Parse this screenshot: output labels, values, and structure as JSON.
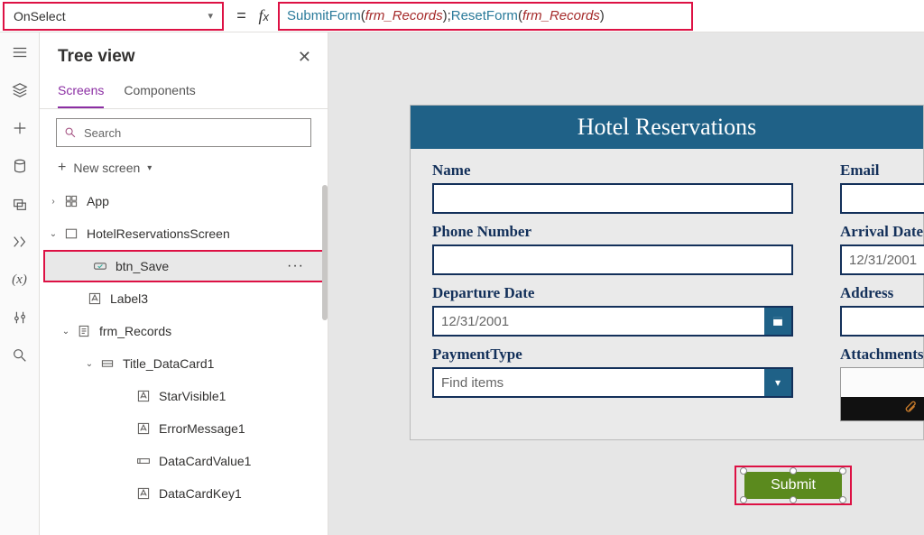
{
  "property_selector": {
    "value": "OnSelect"
  },
  "formula": {
    "fn1": "SubmitForm",
    "arg1": "frm_Records",
    "fn2": "ResetForm",
    "arg2": "frm_Records"
  },
  "tree": {
    "title": "Tree view",
    "tabs": {
      "screens": "Screens",
      "components": "Components"
    },
    "search_placeholder": "Search",
    "new_screen": "New screen",
    "nodes": {
      "app": "App",
      "screen": "HotelReservationsScreen",
      "btn_save": "btn_Save",
      "label3": "Label3",
      "frm_records": "frm_Records",
      "title_dc": "Title_DataCard1",
      "starvisible": "StarVisible1",
      "errormsg": "ErrorMessage1",
      "dcv": "DataCardValue1",
      "dck": "DataCardKey1"
    }
  },
  "app": {
    "title": "Hotel Reservations",
    "fields": {
      "name": "Name",
      "email": "Email",
      "phone": "Phone Number",
      "arrival": "Arrival Date",
      "arrival_val": "12/31/2001",
      "departure": "Departure Date",
      "departure_val": "12/31/2001",
      "address": "Address",
      "paytype": "PaymentType",
      "paytype_val": "Find items",
      "attachments": "Attachments"
    },
    "submit": "Submit"
  }
}
